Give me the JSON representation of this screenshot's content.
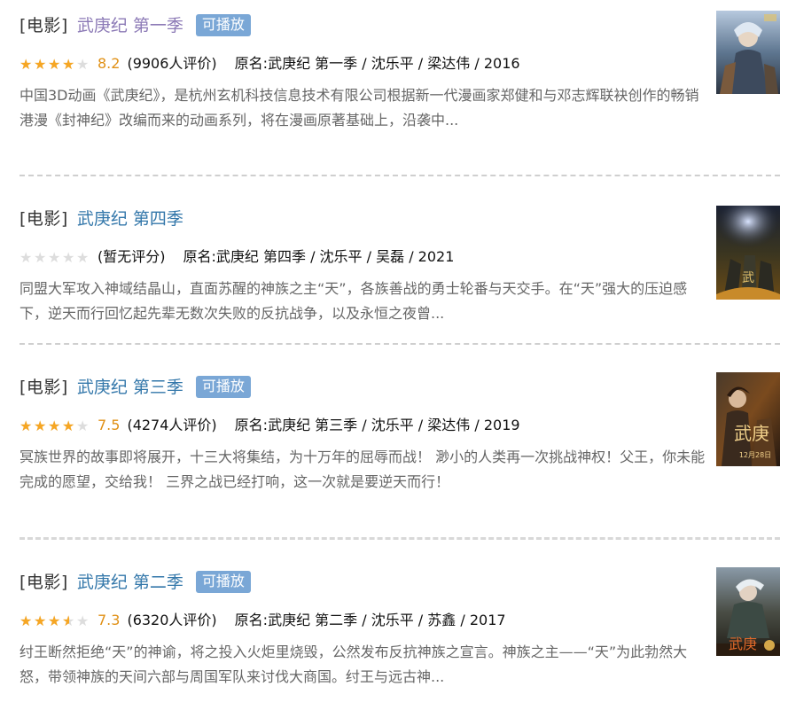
{
  "items": [
    {
      "category": "[电影]",
      "title": "武庚纪  第一季",
      "playable": "可播放",
      "rating": 4,
      "score": "8.2",
      "votes": "(9906人评价)",
      "original": "原名:武庚纪 第一季 / 沈乐平 / 梁达伟 / 2016",
      "desc": "中国3D动画《武庚纪》，是杭州玄机科技信息技术有限公司根据新一代漫画家郑健和与邓志辉联袂创作的畅销港漫《封神纪》改编而来的动画系列，将在漫画原著基础上，沿袭中..."
    },
    {
      "category": "[电影]",
      "title": "武庚纪  第四季",
      "rating": 0,
      "votes": "(暂无评分)",
      "original": "原名:武庚纪 第四季 / 沈乐平 / 吴磊 / 2021",
      "desc": "同盟大军攻入神域结晶山，直面苏醒的神族之主“天”，各族善战的勇士轮番与天交手。在“天”强大的压迫感下，逆天而行回忆起先辈无数次失败的反抗战争，以及永恒之夜曾..."
    },
    {
      "category": "[电影]",
      "title": "武庚纪  第三季",
      "playable": "可播放",
      "rating": 4,
      "score": "7.5",
      "votes": "(4274人评价)",
      "original": "原名:武庚纪 第三季 / 沈乐平 / 梁达伟 / 2019",
      "desc": "冥族世界的故事即将展开，十三大将集结，为十万年的屈辱而战！ 渺小的人类再一次挑战神权！父王，你未能完成的愿望，交给我！ 三界之战已经打响，这一次就是要逆天而行！"
    },
    {
      "category": "[电影]",
      "title": "武庚纪  第二季",
      "playable": "可播放",
      "rating": 3.5,
      "score": "7.3",
      "votes": "(6320人评价)",
      "original": "原名:武庚纪 第二季 / 沈乐平 / 苏鑫 / 2017",
      "desc": "纣王断然拒绝“天”的神谕，将之投入火炬里烧毁，公然发布反抗神族之宣言。神族之主——“天”为此勃然大怒，带领神族的天间六部与周国军队来讨伐大商国。纣王与远古神..."
    }
  ],
  "colors": {
    "link": "#3377aa",
    "visited_link": "#8c7ab6",
    "star": "#f6a623",
    "score": "#e09015",
    "badge": "#7aa7d6"
  }
}
